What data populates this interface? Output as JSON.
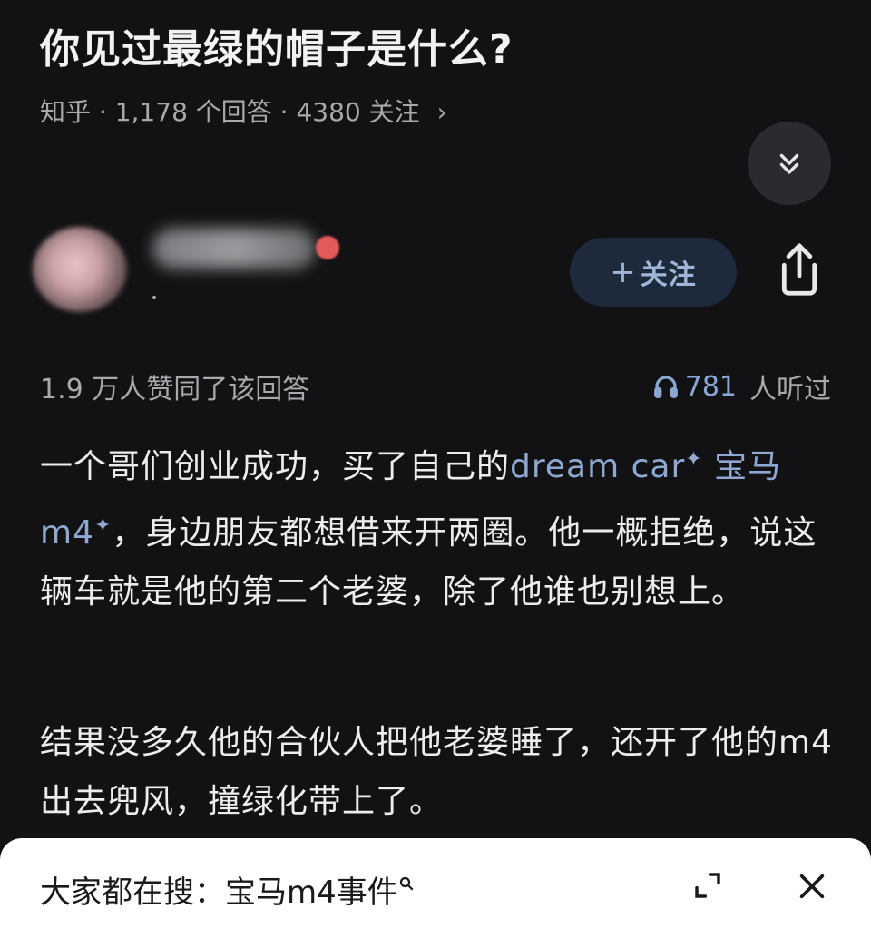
{
  "question": {
    "title": "你见过最绿的帽子是什么?",
    "source": "知乎",
    "answers": "1,178 个回答",
    "follows": "4380 关注",
    "chevron": "›"
  },
  "author": {
    "follow_label": "关注",
    "follow_plus": "+"
  },
  "stats": {
    "likes": "1.9 万人赞同了该回答",
    "listen_count": "781",
    "listen_label": "人听过"
  },
  "answer": {
    "p1_a": "一个哥们创业成功，买了自己的",
    "p1_link1": "dream car",
    "p1_link2": "宝马m4",
    "p1_b": "，身边朋友都想借来开两圈。他一概拒绝，说这辆车就是他的第二个老婆，除了他谁也别想上。",
    "p2": "结果没多久他的合伙人把他老婆睡了，还开了他的m4出去兜风，撞绿化带上了。"
  },
  "search_bar": {
    "label": "大家都在搜：",
    "query": "宝马m4事件",
    "query_icon": "search-icon"
  },
  "icons": {
    "collapse": "chevrons-down-icon",
    "share": "share-icon",
    "headphones": "headphones-icon",
    "expand": "expand-icon",
    "close": "close-icon"
  }
}
